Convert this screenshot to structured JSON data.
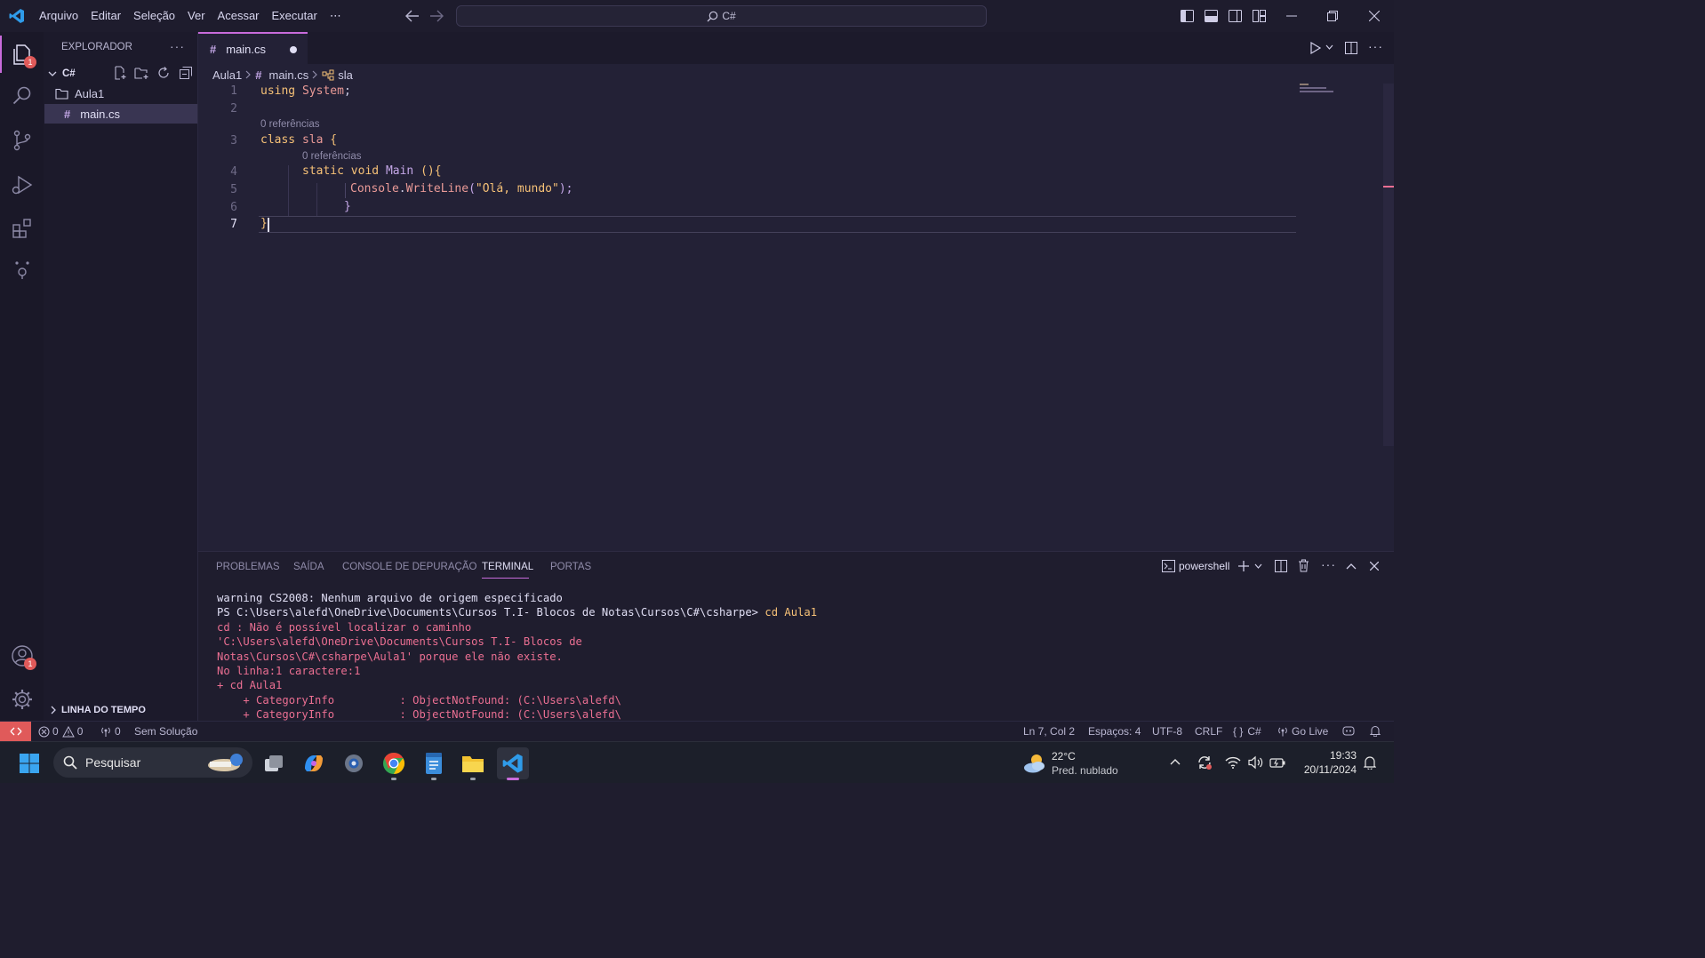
{
  "menu": [
    "Arquivo",
    "Editar",
    "Seleção",
    "Ver",
    "Acessar",
    "Executar",
    "⋯"
  ],
  "command_center": {
    "label": "C#"
  },
  "activity": {
    "explorer_badge": "1",
    "accounts_badge": "1"
  },
  "sidebar": {
    "title": "EXPLORADOR",
    "more": "···",
    "workspace": "C#",
    "folder": "Aula1",
    "file": "main.cs",
    "file_icon": "#",
    "timeline": "LINHA DO TEMPO"
  },
  "tab": {
    "icon": "#",
    "label": "main.cs"
  },
  "breadcrumb": {
    "folder": "Aula1",
    "file": "main.cs",
    "file_icon": "#",
    "symbol": "sla"
  },
  "code": {
    "line_numbers": [
      "1",
      "2",
      "3",
      "4",
      "5",
      "6",
      "7"
    ],
    "ref_lens_1": "0 referências",
    "ref_lens_2": "0 referências",
    "l1_kw": "using",
    "l1_ns": "System",
    "l1_end": ";",
    "l3_kw": "class",
    "l3_name": "sla",
    "l3_brace": "{",
    "l4_kw1": "static",
    "l4_kw2": "void",
    "l4_name": "Main",
    "l4_paren": " (){",
    "l5_cls": "Console",
    "l5_dot": ".",
    "l5_fn": "WriteLine",
    "l5_open": "(",
    "l5_str": "\"Olá, mundo\"",
    "l5_close": ");",
    "l6_brace": "}",
    "l7_brace": "}"
  },
  "panel": {
    "tabs": [
      "PROBLEMAS",
      "SAÍDA",
      "CONSOLE DE DEPURAÇÃO",
      "TERMINAL",
      "PORTAS"
    ],
    "active_tab": "TERMINAL",
    "shell": "powershell",
    "terminal": {
      "line1": "warning CS2008: Nenhum arquivo de origem especificado",
      "prompt": "PS C:\\Users\\alefd\\OneDrive\\Documents\\Cursos T.I- Blocos de Notas\\Cursos\\C#\\csharpe> ",
      "command": "cd Aula1",
      "err1": "cd : Não é possível localizar o caminho",
      "err2": "'C:\\Users\\alefd\\OneDrive\\Documents\\Cursos T.I- Blocos de",
      "err3": "Notas\\Cursos\\C#\\csharpe\\Aula1' porque ele não existe.",
      "err4": "No linha:1 caractere:1",
      "err5": "+ cd Aula1",
      "err6": "    + CategoryInfo          : ObjectNotFound: (C:\\Users\\alefd\\",
      "err7": "    + CategoryInfo          : ObjectNotFound: (C:\\Users\\alefd\\"
    }
  },
  "status": {
    "errors": "0",
    "warnings": "0",
    "ports": "0",
    "solution": "Sem Solução",
    "position": "Ln 7, Col 2",
    "spaces": "Espaços: 4",
    "encoding": "UTF-8",
    "eol": "CRLF",
    "language": "C#",
    "golive": "Go Live"
  },
  "taskbar": {
    "search": "Pesquisar",
    "weather_temp": "22°C",
    "weather_desc": "Pred. nublado",
    "time": "19:33",
    "date": "20/11/2024"
  },
  "colors": {
    "accent": "#c86bdb",
    "error": "#eb6f92",
    "keyword": "#f6c177"
  }
}
